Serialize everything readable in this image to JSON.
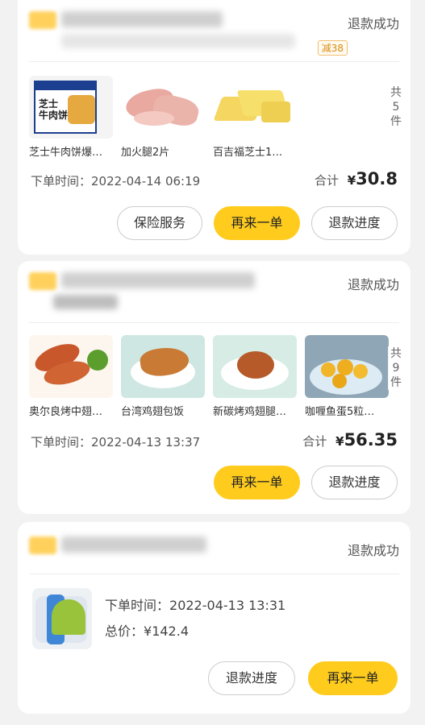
{
  "orders": [
    {
      "status": "退款成功",
      "promo": "减38",
      "products": [
        {
          "name": "芝士牛肉饼爆…",
          "label": "芝士\n牛肉饼"
        },
        {
          "name": "加火腿2片"
        },
        {
          "name": "百吉福芝士1…"
        }
      ],
      "count": "共\n5\n件",
      "time_label": "下单时间：",
      "time": "2022-04-14 06:19",
      "total_label": "合计",
      "currency": "¥",
      "total": "30.8",
      "buttons": [
        "保险服务",
        "再来一单",
        "退款进度"
      ]
    },
    {
      "status": "退款成功",
      "products": [
        {
          "name": "奥尔良烤中翅…"
        },
        {
          "name": "台湾鸡翅包饭"
        },
        {
          "name": "新碳烤鸡翅腿…"
        },
        {
          "name": "咖喱鱼蛋5粒…"
        }
      ],
      "count": "共\n9\n件",
      "time_label": "下单时间：",
      "time": "2022-04-13 13:37",
      "total_label": "合计",
      "currency": "¥",
      "total": "56.35",
      "buttons": [
        "再来一单",
        "退款进度"
      ]
    },
    {
      "status": "退款成功",
      "time_label": "下单时间：",
      "time": "2022-04-13 13:31",
      "total_label": "总价：",
      "total": "¥142.4",
      "buttons": [
        "退款进度",
        "再来一单"
      ]
    }
  ]
}
